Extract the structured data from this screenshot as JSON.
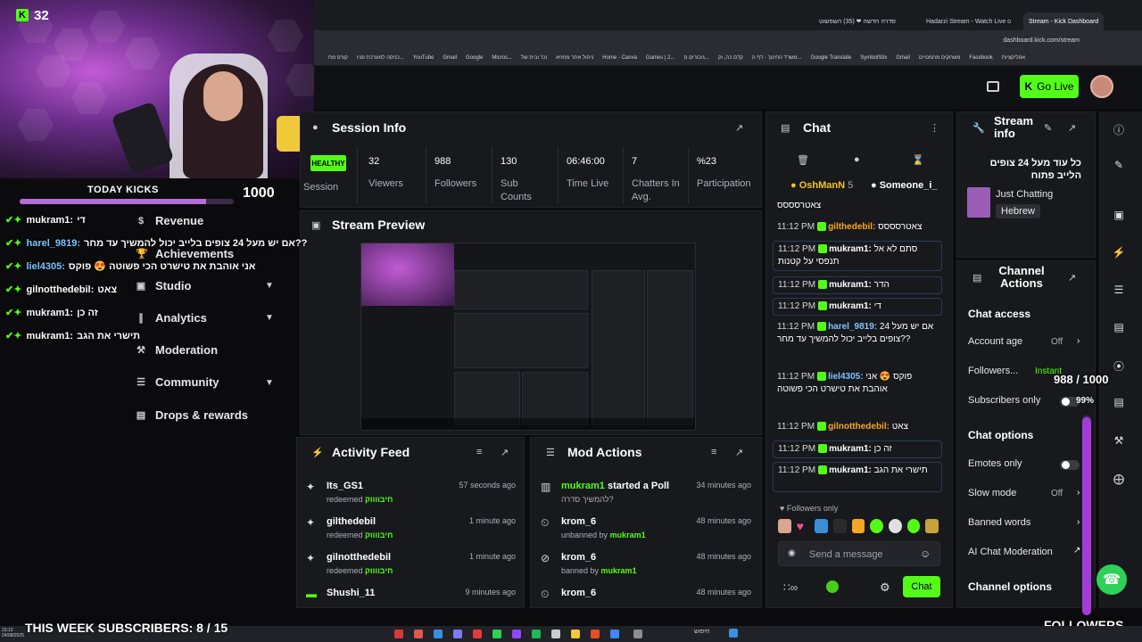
{
  "browser": {
    "tabs": [
      "סדרה חדשה ❤ (35) השפשוט",
      "Hadarzi Stream - Watch Live o",
      "Stream - Kick Dashboard"
    ],
    "url": "dashboard.kick.com/stream",
    "bookmarks": [
      "קורס מח",
      "כניסה למערכת פניו...",
      "YouTube",
      "Gmail",
      "Google",
      "Micros...",
      "וכו' ובית של",
      "ניהול אתר מחזיא",
      "Home - Canva",
      "Games | 2...",
      "גיבורים ס...",
      "קדם כה, וק",
      "משרד החינוך - דף ה...",
      "Google Translate",
      "SymbolStix",
      "Gmail",
      "משחקים מתמטיים",
      "Facebook",
      "אפליקציות"
    ]
  },
  "header": {
    "go_live_label": "Go Live"
  },
  "webcam": {
    "kick_count": "32",
    "today_kicks_label": "TODAY KICKS",
    "today_kicks_value": "1000",
    "today_kicks_progress": 0.87
  },
  "overlay_chat": [
    {
      "user": "mukram1:",
      "text": "די",
      "blue": false
    },
    {
      "user": "harel_9819:",
      "text": "אם יש מעל 24 צופים בלייב יכול להמשיך עד מחר??",
      "blue": true
    },
    {
      "user": "liel4305:",
      "text": "אני אוהבת את טישרט הכי פשוטה 😍 פוקס",
      "blue": true
    },
    {
      "user": "gilnotthedebil:",
      "text": "צאט",
      "blue": false
    },
    {
      "user": "mukram1:",
      "text": "זה כן",
      "blue": false
    },
    {
      "user": "mukram1:",
      "text": "תישרי את הגב",
      "blue": false
    }
  ],
  "sidebar": {
    "items": [
      {
        "label": "Revenue",
        "icon": "$"
      },
      {
        "label": "Achievements",
        "icon": "🏆"
      },
      {
        "label": "Studio",
        "icon": "▣"
      },
      {
        "label": "Analytics",
        "icon": "∥"
      },
      {
        "label": "Moderation",
        "icon": "⚒"
      },
      {
        "label": "Community",
        "icon": "☰"
      },
      {
        "label": "Drops & rewards",
        "icon": "▤"
      }
    ]
  },
  "session": {
    "title": "Session Info",
    "health": "HEALTHY",
    "health_label": "Session",
    "stats": [
      {
        "value": "32",
        "label": "Viewers"
      },
      {
        "value": "988",
        "label": "Followers"
      },
      {
        "value": "130",
        "label": "Sub Counts"
      },
      {
        "value": "06:46:00",
        "label": "Time Live"
      },
      {
        "value": "7",
        "label": "Chatters In Avg."
      },
      {
        "value": "%23",
        "label": "Participation"
      }
    ]
  },
  "preview": {
    "title": "Stream Preview"
  },
  "activity": {
    "title": "Activity Feed",
    "items": [
      {
        "user": "Its_GS1",
        "action": "redeemed",
        "reward": "חיבווווק",
        "time": "57 seconds ago"
      },
      {
        "user": "gilthedebil",
        "action": "redeemed",
        "reward": "חיבווווק",
        "time": "1 minute ago"
      },
      {
        "user": "gilnotthedebil",
        "action": "redeemed",
        "reward": "חיבווווק",
        "time": "1 minute ago"
      },
      {
        "user": "Shushi_11",
        "action": "",
        "reward": "",
        "time": "9 minutes ago"
      }
    ]
  },
  "mod": {
    "title": "Mod Actions",
    "items": [
      {
        "user": "mukram1",
        "rest": "started a Poll",
        "sub": "להמשיך סדרה?",
        "sub_by": "",
        "time": "34 minutes ago"
      },
      {
        "user": "krom_6",
        "rest": "",
        "sub": "unbanned by",
        "sub_by": "mukram1",
        "time": "48 minutes ago"
      },
      {
        "user": "krom_6",
        "rest": "",
        "sub": "banned by",
        "sub_by": "mukram1",
        "time": "48 minutes ago"
      },
      {
        "user": "krom_6",
        "rest": "",
        "sub": "",
        "sub_by": "",
        "time": "48 minutes ago"
      }
    ]
  },
  "chat": {
    "title": "Chat",
    "pinned": [
      {
        "name": "OshManN",
        "count": "5"
      },
      {
        "name": "Someone_i_",
        "count": ""
      }
    ],
    "messages": [
      {
        "time": "",
        "user": "",
        "color": "#fff",
        "text": "צאטרסססס"
      },
      {
        "time": "11:12 PM",
        "user": "gilthedebil:",
        "color": "#f5a623",
        "text": "צאטרסססס"
      },
      {
        "time": "11:12 PM",
        "user": "mukram1:",
        "color": "#fff",
        "text": "סתם לא אל תנפסי על קטנות"
      },
      {
        "time": "11:12 PM",
        "user": "mukram1:",
        "color": "#fff",
        "text": "הדר"
      },
      {
        "time": "11:12 PM",
        "user": "mukram1:",
        "color": "#fff",
        "text": "די"
      },
      {
        "time": "11:12 PM",
        "user": "harel_9819:",
        "color": "#7fc3ff",
        "text": "אם יש מעל 24 צופים בלייב יכול להמשיך עד מחר??"
      },
      {
        "time": "11:12 PM",
        "user": "liel4305:",
        "color": "#7fc3ff",
        "text": "פוקס 😍 אני אוהבת את טישרט הכי פשוטה"
      },
      {
        "time": "11:12 PM",
        "user": "gilnotthedebil:",
        "color": "#f5a623",
        "text": "צאט"
      },
      {
        "time": "11:12 PM",
        "user": "mukram1:",
        "color": "#fff",
        "text": "זה כן"
      },
      {
        "time": "11:12 PM",
        "user": "mukram1:",
        "color": "#fff",
        "text": "תישרי את הגב"
      }
    ],
    "followers_only": "Followers only",
    "placeholder": "Send a message",
    "send_label": "Chat"
  },
  "stream_info": {
    "title": "Stream info",
    "stream_title": "כל עוד מעל 24 צופים הלייב פתוח",
    "category": "Just Chatting",
    "language": "Hebrew"
  },
  "channel_actions": {
    "title": "Channel Actions",
    "chat_access": "Chat access",
    "account_age": "Account age",
    "account_age_val": "Off",
    "followers": "Followers...",
    "followers_val": "Instant",
    "subscribers_only": "Subscribers only",
    "chat_options": "Chat options",
    "emotes_only": "Emotes only",
    "slow_mode": "Slow mode",
    "slow_mode_val": "Off",
    "banned_words": "Banned words",
    "ai_mod": "AI Chat Moderation",
    "channel_options": "Channel options"
  },
  "overlay_goals": {
    "followers_goal": "988 / 1000",
    "followers_pct": "99%",
    "followers_label": "FOLLOWERS",
    "subs_label": "THIS WEEK SUBSCRIBERS: 8 / 15"
  },
  "taskbar": {
    "search": "חיפוש",
    "time": "23:13",
    "date": "24/08/2025"
  }
}
